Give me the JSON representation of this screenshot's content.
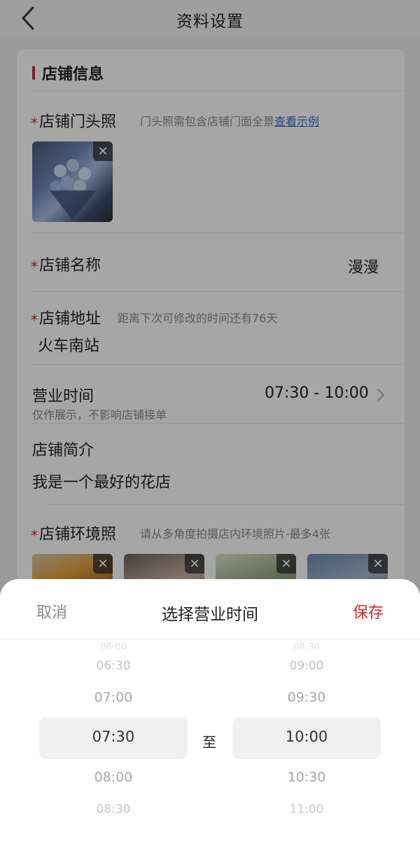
{
  "nav": {
    "title": "资料设置"
  },
  "shop_info": {
    "section_title": "店铺信息",
    "storefront_photo": {
      "label": "店铺门头照",
      "hint": "门头照需包含店铺门面全景",
      "hint_link": "查看示例",
      "remove_symbol": "✕"
    },
    "name": {
      "label": "店铺名称",
      "value": "漫漫"
    },
    "address": {
      "label": "店铺地址",
      "hint": "距离下次可修改的时间还有76天",
      "value": "火车南站"
    },
    "hours": {
      "label": "营业时间",
      "sub": "仅作展示，不影响店铺接单",
      "value": "07:30 - 10:00"
    },
    "intro": {
      "label": "店铺简介",
      "value": "我是一个最好的花店"
    },
    "environment": {
      "label": "店铺环境照",
      "hint": "请从多角度拍摄店内环境照片-最多4张",
      "photo_count": 4
    },
    "required_mark": "*"
  },
  "time_picker": {
    "cancel": "取消",
    "title": "选择营业时间",
    "save": "保存",
    "separator": "至",
    "start": {
      "items": [
        "06:00",
        "06:30",
        "07:00",
        "07:30",
        "08:00",
        "08:30"
      ],
      "selected": "07:30"
    },
    "end": {
      "items": [
        "08:30",
        "09:00",
        "09:30",
        "10:00",
        "10:30",
        "11:00"
      ],
      "selected": "10:00"
    }
  },
  "colors": {
    "accent": "#d8262e",
    "link": "#2d6cc7"
  }
}
